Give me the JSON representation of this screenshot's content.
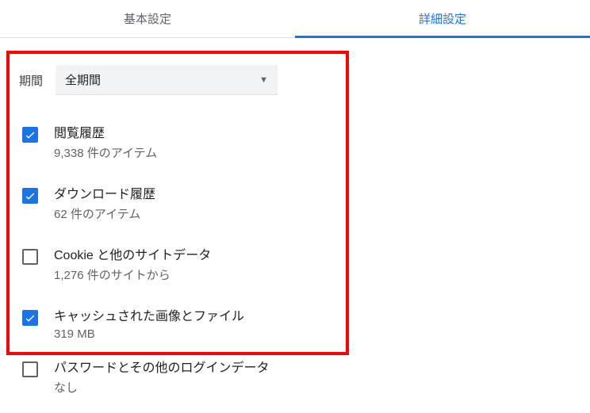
{
  "tabs": {
    "basic": "基本設定",
    "advanced": "詳細設定"
  },
  "range": {
    "label": "期間",
    "value": "全期間"
  },
  "options": [
    {
      "title": "閲覧履歴",
      "sub": "9,338 件のアイテム",
      "checked": true
    },
    {
      "title": "ダウンロード履歴",
      "sub": "62 件のアイテム",
      "checked": true
    },
    {
      "title": "Cookie と他のサイトデータ",
      "sub": "1,276 件のサイトから",
      "checked": false
    },
    {
      "title": "キャッシュされた画像とファイル",
      "sub": "319 MB",
      "checked": true
    }
  ],
  "extra_option": {
    "title": "パスワードとその他のログインデータ",
    "sub": "なし",
    "checked": false
  }
}
